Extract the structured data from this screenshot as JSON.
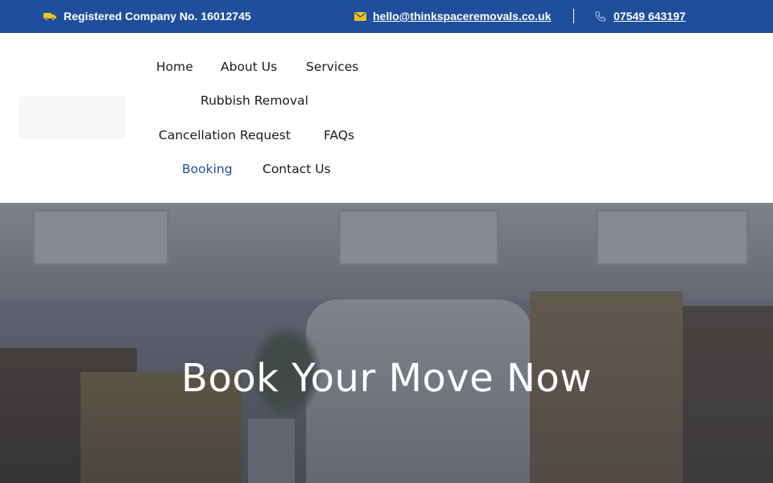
{
  "topbar": {
    "registration": "Registered Company No. 16012745",
    "email": "hello@thinkspaceremovals.co.uk",
    "phone": "07549 643197",
    "icons": {
      "registration": "van-icon",
      "email": "envelope-icon",
      "phone": "phone-icon"
    },
    "colors": {
      "background": "#1f4e9c",
      "icon_accent": "#f3c316"
    }
  },
  "nav": {
    "items": [
      {
        "label": "Home"
      },
      {
        "label": "About Us"
      },
      {
        "label": "Services"
      },
      {
        "label": "Rubbish Removal"
      },
      {
        "label": "Cancellation Request"
      },
      {
        "label": "FAQs"
      },
      {
        "label": "Booking",
        "active": true
      },
      {
        "label": "Contact Us"
      }
    ],
    "active_color": "#1f4e9c"
  },
  "hero": {
    "title": "Book Your Move Now"
  }
}
